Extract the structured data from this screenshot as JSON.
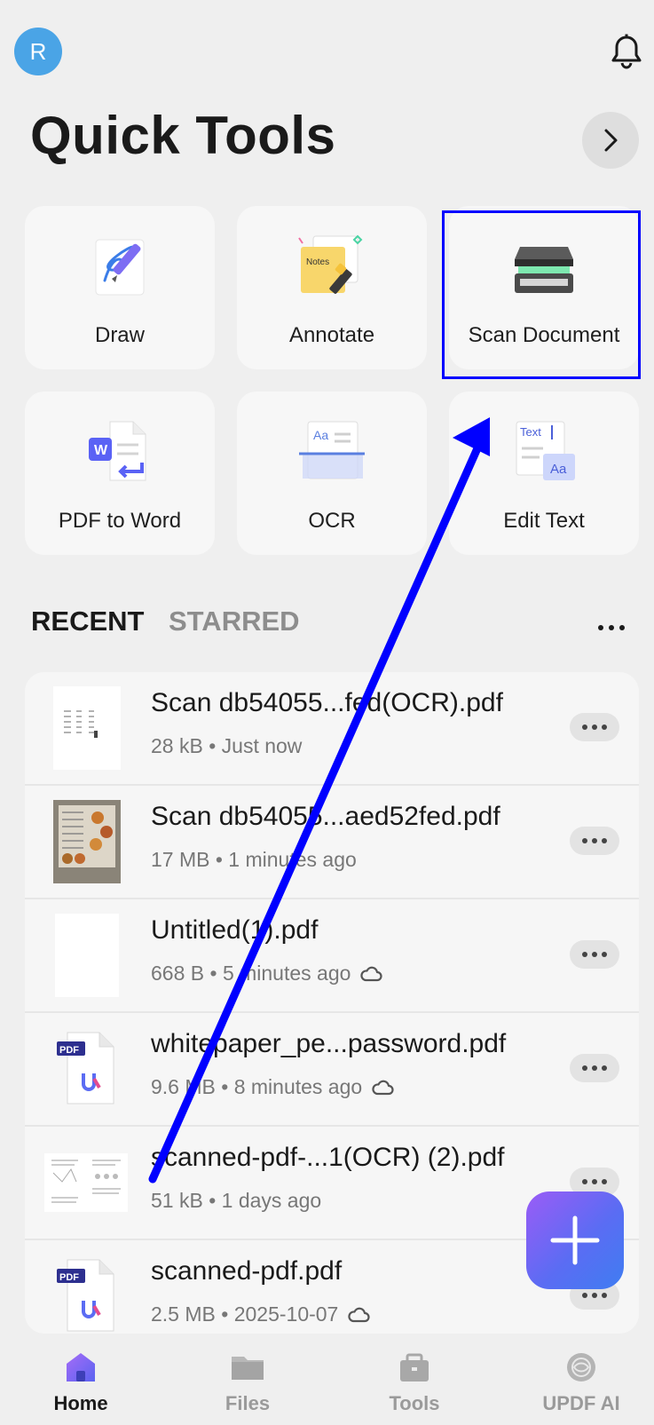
{
  "header": {
    "avatar_letter": "R",
    "title": "Quick Tools"
  },
  "tools": [
    {
      "label": "Draw",
      "icon": "draw-icon"
    },
    {
      "label": "Annotate",
      "icon": "annotate-icon"
    },
    {
      "label": "Scan Document",
      "icon": "scanner-icon"
    },
    {
      "label": "PDF to Word",
      "icon": "pdf-to-word-icon"
    },
    {
      "label": "OCR",
      "icon": "ocr-icon"
    },
    {
      "label": "Edit Text",
      "icon": "edit-text-icon"
    }
  ],
  "annotate_note_text": "Notes",
  "ocr_icon_text": "Aa",
  "edit_text_icon_text": "Text",
  "edit_text_icon_sub": "Aa",
  "pdf_to_word_badge": "W",
  "tabs": {
    "recent": "RECENT",
    "starred": "STARRED"
  },
  "files": [
    {
      "name": "Scan db54055...fed(OCR).pdf",
      "meta": "28 kB • Just now",
      "cloud": false,
      "thumb": "scan-page"
    },
    {
      "name": "Scan db54055...aed52fed.pdf",
      "meta": "17 MB • 1 minutes ago",
      "cloud": false,
      "thumb": "menu-photo"
    },
    {
      "name": "Untitled(1).pdf",
      "meta": "668 B • 5 minutes ago",
      "cloud": true,
      "thumb": "blank"
    },
    {
      "name": "whitepaper_pe...password.pdf",
      "meta": "9.6 MB • 8 minutes ago",
      "cloud": true,
      "thumb": "pdf-file-icon"
    },
    {
      "name": "scanned-pdf-...1(OCR) (2).pdf",
      "meta": "51 kB • 1 days ago",
      "cloud": false,
      "thumb": "doc-page"
    },
    {
      "name": "scanned-pdf.pdf",
      "meta": "2.5 MB • 2025-10-07",
      "cloud": true,
      "thumb": "pdf-file-icon"
    }
  ],
  "pdf_badge": "PDF",
  "nav": [
    {
      "label": "Home",
      "active": true
    },
    {
      "label": "Files",
      "active": false
    },
    {
      "label": "Tools",
      "active": false
    },
    {
      "label": "UPDF AI",
      "active": false
    }
  ],
  "colors": {
    "highlight_box": "#0000ff",
    "arrow": "#0000ff",
    "avatar": "#4aa4e6",
    "nav_active": "#7c5cf5"
  }
}
